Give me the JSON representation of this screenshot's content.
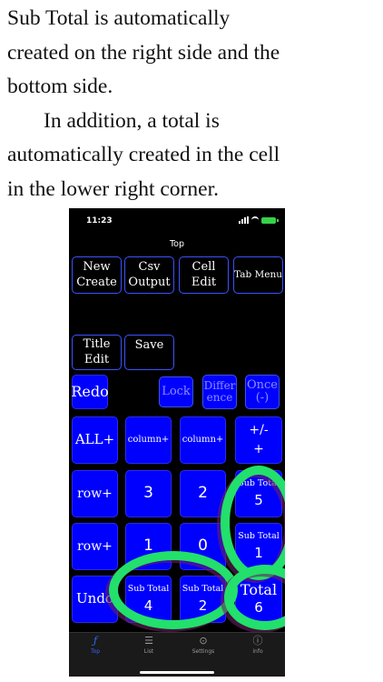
{
  "caption": {
    "line1": "Sub Total is automatically",
    "line2": "created on the right side and the",
    "line3": "bottom side.",
    "line4": "In addition, a total is",
    "line5": "automatically created in the cell",
    "line6": "in the lower right corner."
  },
  "status_bar": {
    "time": "11:23"
  },
  "nav": {
    "title": "Top"
  },
  "toolbar": {
    "new_create": [
      "New",
      "Create"
    ],
    "csv_output": [
      "Csv",
      "Output"
    ],
    "cell_edit": [
      "Cell",
      "Edit"
    ],
    "tab_menu": "Tab Menu",
    "title_edit": [
      "Title",
      "Edit"
    ],
    "save": "Save"
  },
  "controls": {
    "redo": "Redo",
    "lock": "Lock",
    "difference": [
      "Differ",
      "ence"
    ],
    "once": [
      "Once",
      "(-)"
    ]
  },
  "grid": {
    "all_plus": "ALL+",
    "column_plus_1": "column+",
    "column_plus_2": "column+",
    "plus_minus": [
      "+/-",
      "+"
    ],
    "row_plus_1": "row+",
    "cell_3": "3",
    "cell_2": "2",
    "subtotal_right_1": {
      "label": "Sub Total",
      "value": "5"
    },
    "row_plus_2": "row+",
    "cell_1": "1",
    "cell_0": "0",
    "subtotal_right_2": {
      "label": "Sub Total",
      "value": "1"
    },
    "undo": "Undo",
    "subtotal_bottom_1": {
      "label": "Sub Total",
      "value": "4"
    },
    "subtotal_bottom_2": {
      "label": "Sub Total",
      "value": "2"
    },
    "total": {
      "label": "Total",
      "value": "6"
    }
  },
  "tab_bar": {
    "tabs": [
      {
        "label": "Top",
        "icon": "function-icon"
      },
      {
        "label": "List",
        "icon": "list-icon"
      },
      {
        "label": "Settings",
        "icon": "play-circle-icon"
      },
      {
        "label": "info",
        "icon": "info-icon"
      }
    ]
  },
  "colors": {
    "button_blue": "#0000ff",
    "border_blue": "#3a52ff",
    "highlight_ring": "#22e06b",
    "active_tab": "#2f6bff"
  }
}
